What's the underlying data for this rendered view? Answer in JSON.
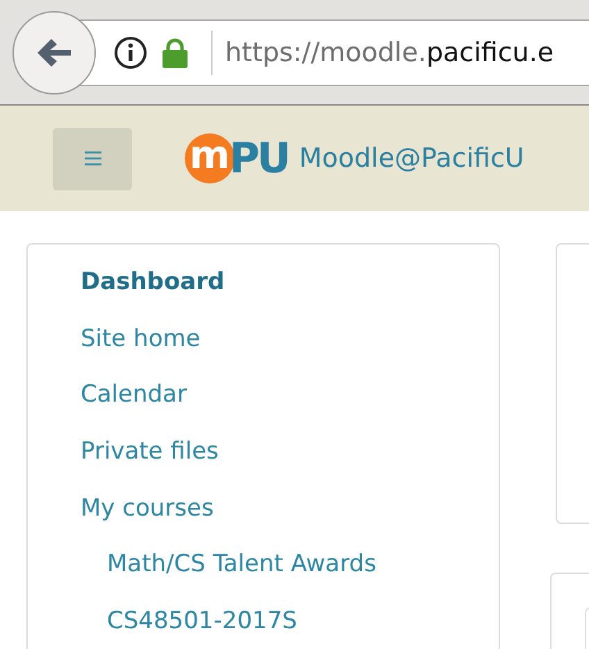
{
  "browser": {
    "url_scheme_subdomain": "https://moodle.",
    "url_domain": "pacificu.e",
    "secure": true
  },
  "header": {
    "logo": {
      "mark": "m",
      "letters": "PU"
    },
    "site_name": "Moodle@PacificU"
  },
  "nav": [
    {
      "label": "Dashboard",
      "selected": true
    },
    {
      "label": "Site home",
      "selected": false
    },
    {
      "label": "Calendar",
      "selected": false
    },
    {
      "label": "Private files",
      "selected": false
    },
    {
      "label": "My courses",
      "selected": false,
      "children": [
        {
          "label": "Math/CS Talent Awards",
          "selected": false
        },
        {
          "label": "CS48501-2017S",
          "selected": false
        }
      ]
    }
  ]
}
